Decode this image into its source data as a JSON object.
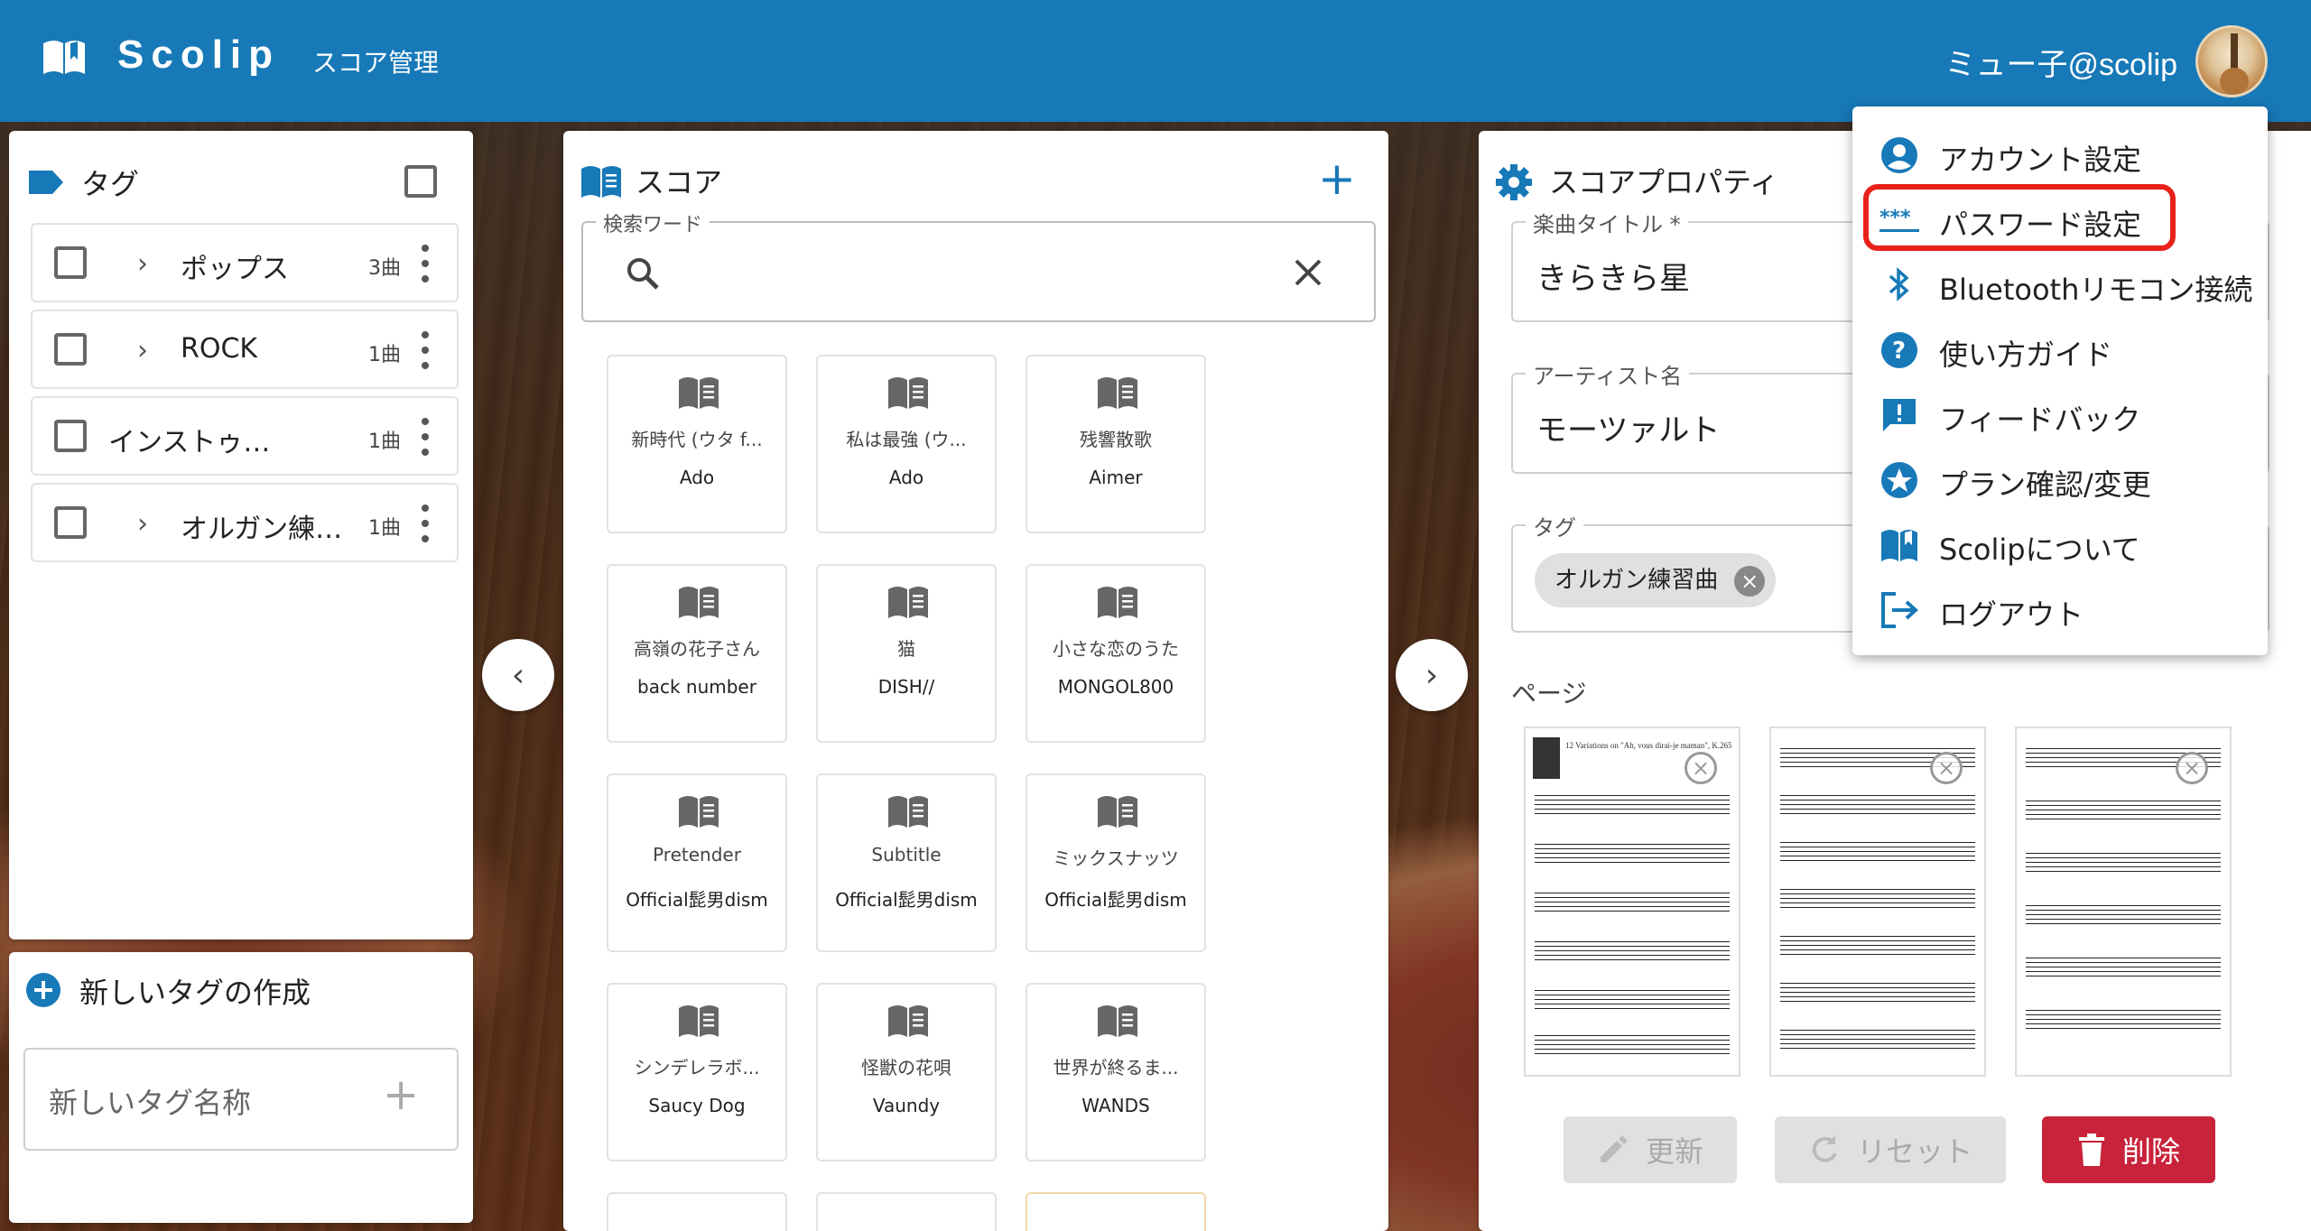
{
  "app": {
    "name": "Scolip",
    "section": "スコア管理",
    "user": "ミュー子@scolip"
  },
  "tags_panel": {
    "title": "タグ",
    "items": [
      {
        "label": "ポップス",
        "count": "3曲",
        "expandable": true
      },
      {
        "label": "ROCK",
        "count": "1曲",
        "expandable": true
      },
      {
        "label": "インストゥ…",
        "count": "1曲",
        "expandable": false
      },
      {
        "label": "オルガン練…",
        "count": "1曲",
        "expandable": true
      }
    ]
  },
  "new_tag": {
    "title": "新しいタグの作成",
    "placeholder": "新しいタグ名称"
  },
  "score_panel": {
    "title": "スコア",
    "search_legend": "検索ワード",
    "cards": [
      {
        "title": "新時代 (ウタ f...",
        "artist": "Ado"
      },
      {
        "title": "私は最強 (ウ...",
        "artist": "Ado"
      },
      {
        "title": "残響散歌",
        "artist": "Aimer"
      },
      {
        "title": "高嶺の花子さん",
        "artist": "back number"
      },
      {
        "title": "猫",
        "artist": "DISH//"
      },
      {
        "title": "小さな恋のうた",
        "artist": "MONGOL800"
      },
      {
        "title": "Pretender",
        "artist": "Official髭男dism"
      },
      {
        "title": "Subtitle",
        "artist": "Official髭男dism"
      },
      {
        "title": "ミックスナッツ",
        "artist": "Official髭男dism"
      },
      {
        "title": "シンデレラボ...",
        "artist": "Saucy Dog"
      },
      {
        "title": "怪獣の花唄",
        "artist": "Vaundy"
      },
      {
        "title": "世界が終るま...",
        "artist": "WANDS"
      }
    ]
  },
  "properties": {
    "title": "スコアプロパティ",
    "song_title_label": "楽曲タイトル *",
    "song_title_value": "きらきら星",
    "artist_label": "アーティスト名",
    "artist_value": "モーツァルト",
    "tag_label": "タグ",
    "tag_chip": "オルガン練習曲",
    "pages_label": "ページ",
    "page_heading": "12 Variations on \"Ah, vous dirai-je maman\", K.265",
    "update_label": "更新",
    "reset_label": "リセット",
    "delete_label": "削除"
  },
  "user_menu": {
    "items": [
      {
        "label": "アカウント設定",
        "icon": "account-circle-icon"
      },
      {
        "label": "パスワード設定",
        "icon": "password-icon"
      },
      {
        "label": "Bluetoothリモコン接続",
        "icon": "bluetooth-icon"
      },
      {
        "label": "使い方ガイド",
        "icon": "help-icon"
      },
      {
        "label": "フィードバック",
        "icon": "feedback-icon"
      },
      {
        "label": "プラン確認/変更",
        "icon": "star-badge-icon"
      },
      {
        "label": "Scolipについて",
        "icon": "book-open-icon"
      },
      {
        "label": "ログアウト",
        "icon": "logout-icon"
      }
    ]
  },
  "colors": {
    "primary": "#1779b8",
    "danger": "#c8233a",
    "highlight": "#e8211a"
  }
}
